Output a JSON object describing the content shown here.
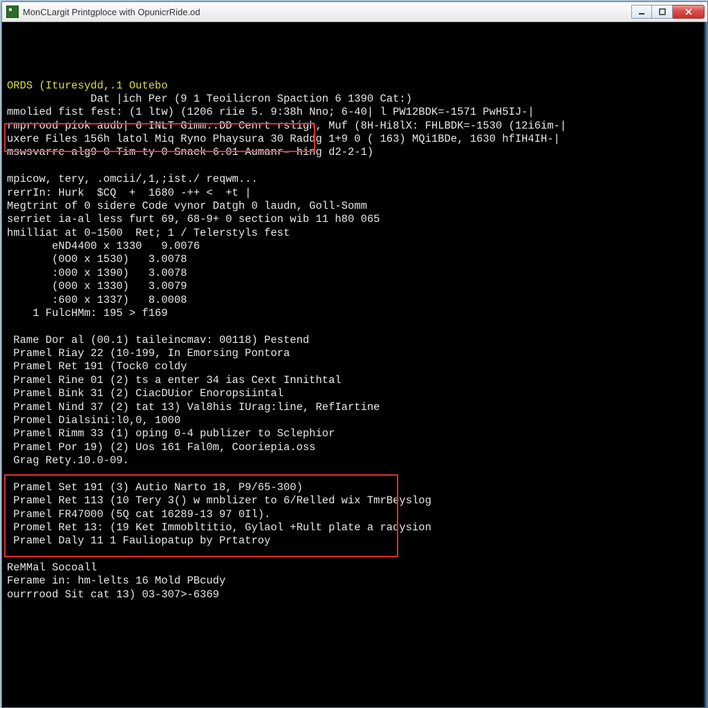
{
  "window": {
    "title": "MonCLargit Printgploce with OpunicrRide.od"
  },
  "terminal": {
    "lines": [
      {
        "cls": "y",
        "text": "ORDS (Ituresydd,.1 Outebo"
      },
      {
        "cls": "w",
        "text": "             Dat |ich Per (9 1 Teoilicron Spaction 6 1390 Cat:)"
      },
      {
        "cls": "w",
        "text": "mmolied fist fest: (1 ltw) (1206 riie 5. 9:38h Nno; 6-40| l PW12BDK=-1571 PwH5IJ-|"
      },
      {
        "cls": "w",
        "text": "rmprrood piok audb| 6 INLT Gimm..DD Cenrt rsligh, Muf (8H-Hi8lX: FHLBDK=-1530 (12i6im-|"
      },
      {
        "cls": "w",
        "text": "uxere Files 156h latol Miq Ryno Phaysura 30 Raddg 1+9 0 ( 163) MQi1BDe, 1630 hfIH4IH-|"
      },
      {
        "cls": "w",
        "text": "mswsvarre alg9 0 Tim ty 0 Snack 6.01 Aumanr– hing d2-2-1)"
      },
      {
        "cls": "w",
        "text": ""
      },
      {
        "cls": "w",
        "text": "mpicow, tery, .omcii/,1,;ist./ reqwm..."
      },
      {
        "cls": "w",
        "text": "rerrIn: Hurk  $CQ  +  1680 -++ <  +t |"
      },
      {
        "cls": "w",
        "text": "Megtrint of 0 sidere Code vynor Datgh 0 laudn, Goll-Somm"
      },
      {
        "cls": "w",
        "text": "serriet ia-al less furt 69, 68-9+ 0 section wib 11 h80 065"
      },
      {
        "cls": "w",
        "text": "hmilliat at 0–1500  Ret; 1 / Telerstyls fest"
      },
      {
        "cls": "w",
        "text": "       eND4400 x 1330   9.0076"
      },
      {
        "cls": "w",
        "text": "       (0O0 x 1530)   3.0078"
      },
      {
        "cls": "w",
        "text": "       :000 x 1390)   3.0078"
      },
      {
        "cls": "w",
        "text": "       (000 x 1330)   3.0079"
      },
      {
        "cls": "w",
        "text": "       :600 x 1337)   8.0008"
      },
      {
        "cls": "w",
        "text": "    1 FulcHMm: 195 > f169"
      },
      {
        "cls": "w",
        "text": ""
      },
      {
        "cls": "w",
        "text": " Rame Dor al (00.1) taileincmav: 00118) Pestend"
      },
      {
        "cls": "w",
        "text": " Pramel Riay 22 (10-199, In Emorsing Pontora"
      },
      {
        "cls": "w",
        "text": " Pramel Ret 191 (Tock0 coldy"
      },
      {
        "cls": "w",
        "text": " Pramel Rine 01 (2) ts a enter 34 ias Cext Innithtal"
      },
      {
        "cls": "w",
        "text": " Pramel Bink 31 (2) CiacDUior Enoropsiintal"
      },
      {
        "cls": "w",
        "text": " Pramel Nind 37 (2) tat 13) Val8his IUrag:line, RefIartine"
      },
      {
        "cls": "w",
        "text": " Promel Dialsini:l0,0, 1000"
      },
      {
        "cls": "w",
        "text": " Pramel Rimm 33 (1) oping 0-4 publizer to Sclephior"
      },
      {
        "cls": "w",
        "text": " Pramel Por 19) (2) Uos 161 Fal0m, Cooriepia.oss"
      },
      {
        "cls": "w",
        "text": " Grag Rety.10.0-09."
      },
      {
        "cls": "w",
        "text": ""
      },
      {
        "cls": "w",
        "text": " Pramel Set 191 (3) Autio Narto 18, P9/65-300)"
      },
      {
        "cls": "w",
        "text": " Pramel Ret 113 (10 Tery 3() w mnblizer to 6/Relled wix TmrBeyslog"
      },
      {
        "cls": "w",
        "text": " Pramel FR47000 (5Q cat 16289-13 97 0Il)."
      },
      {
        "cls": "w",
        "text": " Promel Ret 13: (19 Ket Immobltitio, Gylaol +Rult plate a radysion"
      },
      {
        "cls": "w",
        "text": " Pramel Daly 11 1 Fauliopatup by Prtatroy"
      },
      {
        "cls": "w",
        "text": ""
      },
      {
        "cls": "w",
        "text": "ReMMal Socoall"
      },
      {
        "cls": "w",
        "text": "Ferame in: hm-lelts 16 Mold PBcudy"
      },
      {
        "cls": "w",
        "text": "ourrrood Sit cat 13) 03-307>-6369"
      }
    ]
  }
}
